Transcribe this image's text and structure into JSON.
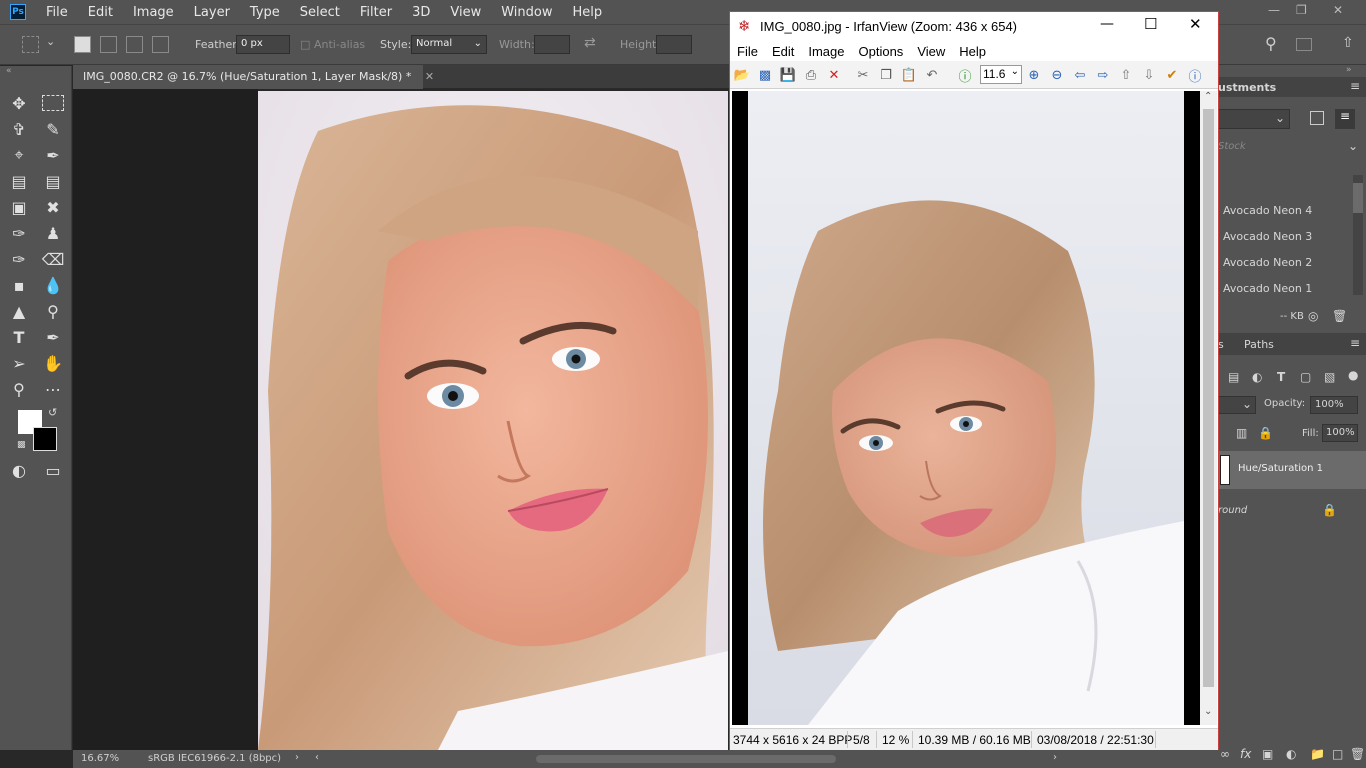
{
  "photoshop": {
    "menu": [
      "File",
      "Edit",
      "Image",
      "Layer",
      "Type",
      "Select",
      "Filter",
      "3D",
      "View",
      "Window",
      "Help"
    ],
    "logo": "Ps",
    "options": {
      "feather_label": "Feather:",
      "feather_value": "0 px",
      "antialias_label": "Anti-alias",
      "style_label": "Style:",
      "style_value": "Normal",
      "width_label": "Width:",
      "height_label": "Height:"
    },
    "doc_tab": "IMG_0080.CR2 @ 16.7% (Hue/Saturation 1, Layer Mask/8) *",
    "status": {
      "zoom": "16.67%",
      "profile": "sRGB IEC61966-2.1 (8bpc)"
    },
    "panels": {
      "adjustments_tab": "ustments",
      "stock_placeholder": "Stock",
      "library_items": [
        "Avocado Neon 4",
        "Avocado Neon 3",
        "Avocado Neon 2",
        "Avocado Neon 1"
      ],
      "library_size": "-- KB",
      "layers_tab_partial": "s",
      "paths_tab": "Paths",
      "opacity_label": "Opacity:",
      "opacity_value": "100%",
      "fill_label": "Fill:",
      "fill_value": "100%",
      "layer_hue": "Hue/Saturation 1",
      "layer_background": "round"
    }
  },
  "irfanview": {
    "title": "IMG_0080.jpg - IrfanView (Zoom: 436 x 654)",
    "menu": [
      "File",
      "Edit",
      "Image",
      "Options",
      "View",
      "Help"
    ],
    "zoom_combo": "11.6",
    "status": {
      "dimensions": "3744 x 5616 x 24 BPP",
      "index": "5/8",
      "zoom": "12 %",
      "size": "10.39 MB / 60.16 MB",
      "datetime": "03/08/2018 / 22:51:30"
    }
  },
  "colors": {
    "ps_chrome": "#535353",
    "ps_canvas": "#282828",
    "iv_border": "#c84040",
    "photo_background": "#e6e6ee"
  }
}
